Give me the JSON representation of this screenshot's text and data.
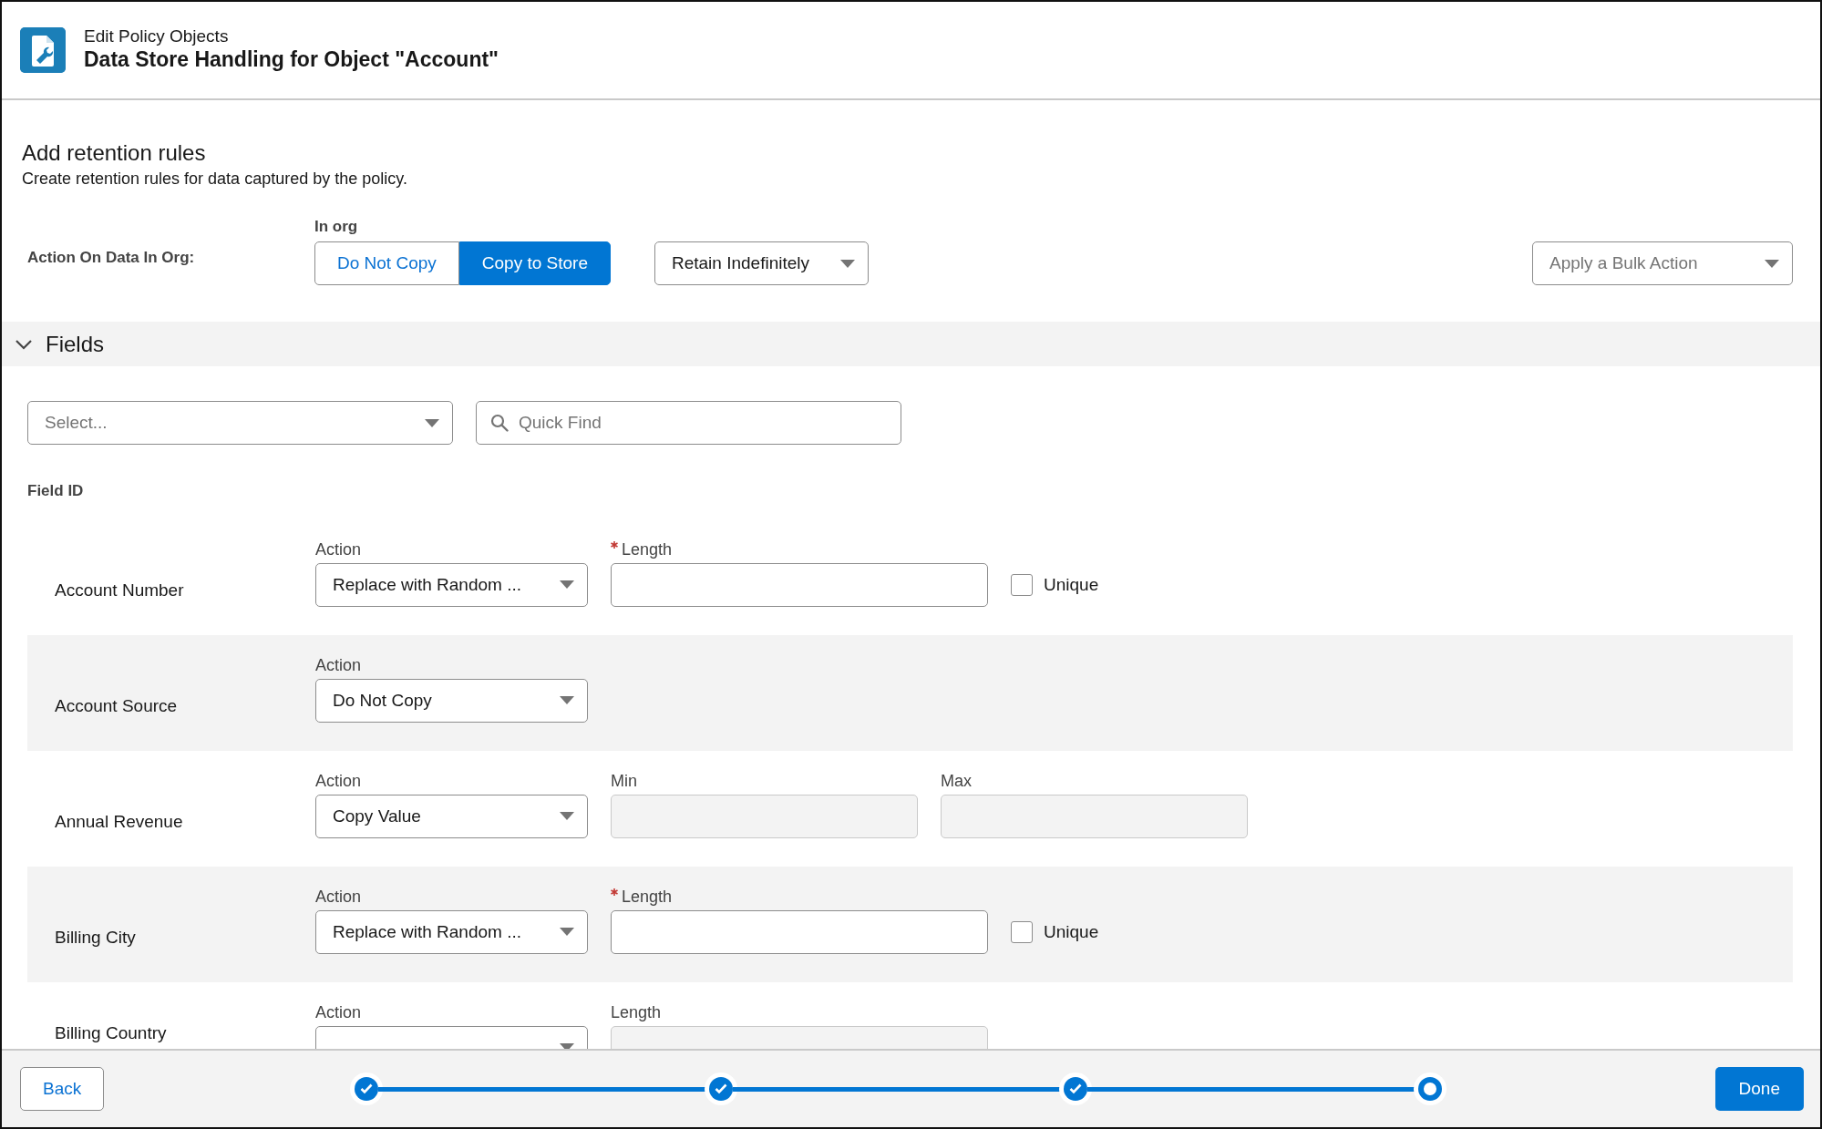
{
  "header": {
    "subtitle": "Edit Policy Objects",
    "title": "Data Store Handling for Object \"Account\""
  },
  "section": {
    "title": "Add retention rules",
    "description": "Create retention rules for data captured by the policy."
  },
  "org_action": {
    "label": "Action On Data In Org:",
    "group_label": "In org",
    "options": [
      {
        "label": "Do Not Copy",
        "selected": false
      },
      {
        "label": "Copy to Store",
        "selected": true
      }
    ],
    "retention": "Retain Indefinitely",
    "bulk_action_placeholder": "Apply a Bulk Action"
  },
  "fields_section": {
    "title": "Fields",
    "expanded": true,
    "filter_placeholder": "Select...",
    "search_placeholder": "Quick Find",
    "column_label": "Field ID"
  },
  "fields": [
    {
      "name": "Account Number",
      "action_label": "Action",
      "action": "Replace with Random ...",
      "inputs": [
        {
          "label": "Length",
          "required": true,
          "disabled": false
        }
      ],
      "checkbox": {
        "label": "Unique",
        "checked": false
      }
    },
    {
      "name": "Account Source",
      "action_label": "Action",
      "action": "Do Not Copy"
    },
    {
      "name": "Annual Revenue",
      "action_label": "Action",
      "action": "Copy Value",
      "inputs": [
        {
          "label": "Min",
          "required": false,
          "disabled": true
        },
        {
          "label": "Max",
          "required": false,
          "disabled": true
        }
      ]
    },
    {
      "name": "Billing City",
      "action_label": "Action",
      "action": "Replace with Random ...",
      "inputs": [
        {
          "label": "Length",
          "required": true,
          "disabled": false
        }
      ],
      "checkbox": {
        "label": "Unique",
        "checked": false
      }
    },
    {
      "name": "Billing Country",
      "action_label": "Action",
      "inputs": [
        {
          "label": "Length",
          "required": false,
          "disabled": true
        }
      ]
    }
  ],
  "footer": {
    "back": "Back",
    "done": "Done",
    "steps": [
      {
        "complete": true
      },
      {
        "complete": true
      },
      {
        "complete": true
      },
      {
        "complete": false
      }
    ]
  }
}
